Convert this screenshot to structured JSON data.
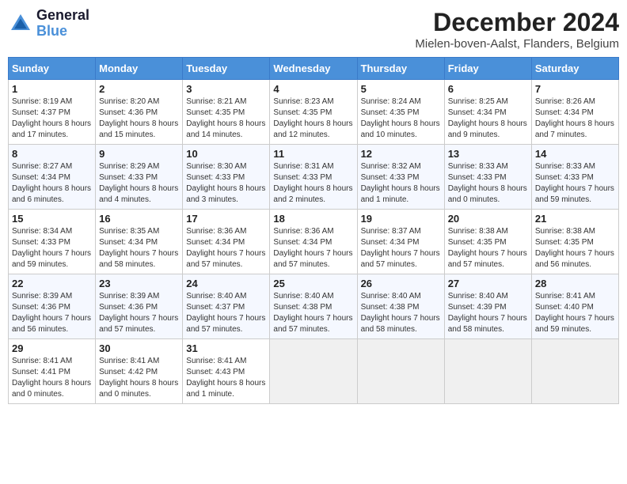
{
  "logo": {
    "line1": "General",
    "line2": "Blue"
  },
  "title": "December 2024",
  "location": "Mielen-boven-Aalst, Flanders, Belgium",
  "days_of_week": [
    "Sunday",
    "Monday",
    "Tuesday",
    "Wednesday",
    "Thursday",
    "Friday",
    "Saturday"
  ],
  "weeks": [
    [
      {
        "day": "1",
        "sunrise": "8:19 AM",
        "sunset": "4:37 PM",
        "daylight": "8 hours and 17 minutes."
      },
      {
        "day": "2",
        "sunrise": "8:20 AM",
        "sunset": "4:36 PM",
        "daylight": "8 hours and 15 minutes."
      },
      {
        "day": "3",
        "sunrise": "8:21 AM",
        "sunset": "4:35 PM",
        "daylight": "8 hours and 14 minutes."
      },
      {
        "day": "4",
        "sunrise": "8:23 AM",
        "sunset": "4:35 PM",
        "daylight": "8 hours and 12 minutes."
      },
      {
        "day": "5",
        "sunrise": "8:24 AM",
        "sunset": "4:35 PM",
        "daylight": "8 hours and 10 minutes."
      },
      {
        "day": "6",
        "sunrise": "8:25 AM",
        "sunset": "4:34 PM",
        "daylight": "8 hours and 9 minutes."
      },
      {
        "day": "7",
        "sunrise": "8:26 AM",
        "sunset": "4:34 PM",
        "daylight": "8 hours and 7 minutes."
      }
    ],
    [
      {
        "day": "8",
        "sunrise": "8:27 AM",
        "sunset": "4:34 PM",
        "daylight": "8 hours and 6 minutes."
      },
      {
        "day": "9",
        "sunrise": "8:29 AM",
        "sunset": "4:33 PM",
        "daylight": "8 hours and 4 minutes."
      },
      {
        "day": "10",
        "sunrise": "8:30 AM",
        "sunset": "4:33 PM",
        "daylight": "8 hours and 3 minutes."
      },
      {
        "day": "11",
        "sunrise": "8:31 AM",
        "sunset": "4:33 PM",
        "daylight": "8 hours and 2 minutes."
      },
      {
        "day": "12",
        "sunrise": "8:32 AM",
        "sunset": "4:33 PM",
        "daylight": "8 hours and 1 minute."
      },
      {
        "day": "13",
        "sunrise": "8:33 AM",
        "sunset": "4:33 PM",
        "daylight": "8 hours and 0 minutes."
      },
      {
        "day": "14",
        "sunrise": "8:33 AM",
        "sunset": "4:33 PM",
        "daylight": "7 hours and 59 minutes."
      }
    ],
    [
      {
        "day": "15",
        "sunrise": "8:34 AM",
        "sunset": "4:33 PM",
        "daylight": "7 hours and 59 minutes."
      },
      {
        "day": "16",
        "sunrise": "8:35 AM",
        "sunset": "4:34 PM",
        "daylight": "7 hours and 58 minutes."
      },
      {
        "day": "17",
        "sunrise": "8:36 AM",
        "sunset": "4:34 PM",
        "daylight": "7 hours and 57 minutes."
      },
      {
        "day": "18",
        "sunrise": "8:36 AM",
        "sunset": "4:34 PM",
        "daylight": "7 hours and 57 minutes."
      },
      {
        "day": "19",
        "sunrise": "8:37 AM",
        "sunset": "4:34 PM",
        "daylight": "7 hours and 57 minutes."
      },
      {
        "day": "20",
        "sunrise": "8:38 AM",
        "sunset": "4:35 PM",
        "daylight": "7 hours and 57 minutes."
      },
      {
        "day": "21",
        "sunrise": "8:38 AM",
        "sunset": "4:35 PM",
        "daylight": "7 hours and 56 minutes."
      }
    ],
    [
      {
        "day": "22",
        "sunrise": "8:39 AM",
        "sunset": "4:36 PM",
        "daylight": "7 hours and 56 minutes."
      },
      {
        "day": "23",
        "sunrise": "8:39 AM",
        "sunset": "4:36 PM",
        "daylight": "7 hours and 57 minutes."
      },
      {
        "day": "24",
        "sunrise": "8:40 AM",
        "sunset": "4:37 PM",
        "daylight": "7 hours and 57 minutes."
      },
      {
        "day": "25",
        "sunrise": "8:40 AM",
        "sunset": "4:38 PM",
        "daylight": "7 hours and 57 minutes."
      },
      {
        "day": "26",
        "sunrise": "8:40 AM",
        "sunset": "4:38 PM",
        "daylight": "7 hours and 58 minutes."
      },
      {
        "day": "27",
        "sunrise": "8:40 AM",
        "sunset": "4:39 PM",
        "daylight": "7 hours and 58 minutes."
      },
      {
        "day": "28",
        "sunrise": "8:41 AM",
        "sunset": "4:40 PM",
        "daylight": "7 hours and 59 minutes."
      }
    ],
    [
      {
        "day": "29",
        "sunrise": "8:41 AM",
        "sunset": "4:41 PM",
        "daylight": "8 hours and 0 minutes."
      },
      {
        "day": "30",
        "sunrise": "8:41 AM",
        "sunset": "4:42 PM",
        "daylight": "8 hours and 0 minutes."
      },
      {
        "day": "31",
        "sunrise": "8:41 AM",
        "sunset": "4:43 PM",
        "daylight": "8 hours and 1 minute."
      },
      null,
      null,
      null,
      null
    ]
  ]
}
